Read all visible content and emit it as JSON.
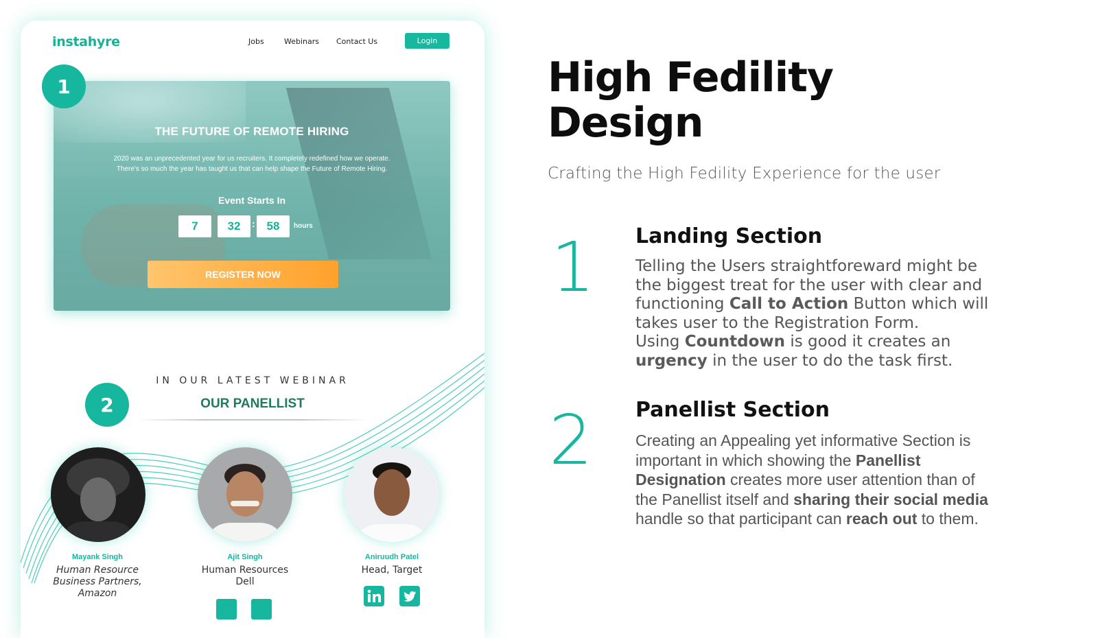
{
  "mockup": {
    "logo": "instahyre",
    "nav": {
      "jobs": "Jobs",
      "webinars": "Webinars",
      "contact": "Contact Us",
      "login": "Login"
    },
    "hero": {
      "badge": "1",
      "title": "THE FUTURE OF REMOTE HIRING",
      "description": "2020 was an unprecedented year for us recruiters. It completely redefined how we operate. There's so much the year has taught us that can help shape the Future of Remote Hiring.",
      "event_starts": "Event Starts In",
      "countdown": [
        "7",
        "32",
        "58"
      ],
      "countdown_unit": "hours",
      "register_label": "REGISTER NOW"
    },
    "panel": {
      "badge": "2",
      "kicker": "IN OUR LATEST WEBINAR",
      "title": "OUR PANELLIST",
      "panellists": [
        {
          "name": "Mayank Singh",
          "role_line1": "Human Resource",
          "role_line2": "Business Partners,",
          "company": "Amazon"
        },
        {
          "name": "Ajit Singh",
          "role": "Human Resources",
          "company": "Dell"
        },
        {
          "name": "Aniruudh Patel",
          "role": "Head, Target"
        }
      ],
      "social_icons": [
        "linkedin-icon",
        "twitter-icon"
      ]
    }
  },
  "right": {
    "headline_line1": "High Fedility",
    "headline_line2": "Design",
    "subtitle": "Crafting the High Fedility Experience for the user",
    "sections": [
      {
        "number": "1",
        "title": "Landing Section",
        "body": [
          "Telling the Users straightforeward might be",
          "the biggest treat for the user with clear and",
          "functioning ",
          "Call to Action",
          " Button which will",
          "takes user to the Registration Form.",
          "Using ",
          "Countdown",
          " is good it creates an",
          "urgency",
          " in the user to do the task first."
        ]
      },
      {
        "number": "2",
        "title": "Panellist Section",
        "body": [
          "Creating an Appealing yet informative Section is",
          "important  in which showing the ",
          "Panellist",
          "Designation",
          " creates more user attention than of",
          "the Panellist itself and ",
          "sharing their social media",
          "handle so that participant can ",
          "reach out",
          " to them."
        ]
      }
    ]
  },
  "colors": {
    "accent": "#16b79e",
    "cta": "#ffa12b",
    "panel_title": "#207a5e"
  }
}
